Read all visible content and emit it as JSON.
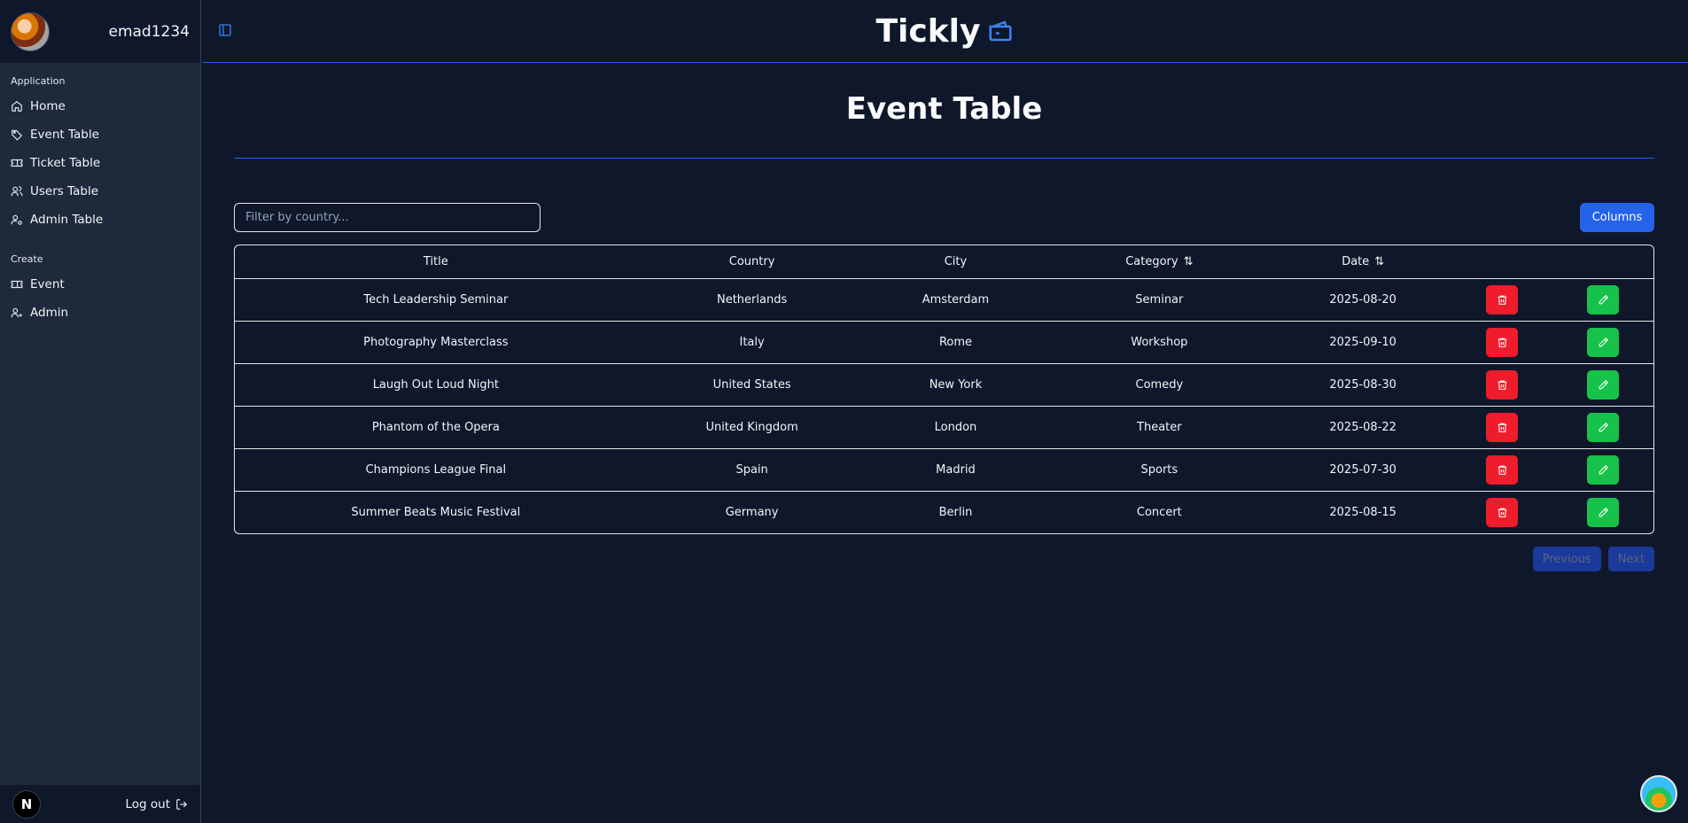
{
  "user": {
    "name": "emad1234"
  },
  "sidebar": {
    "application_label": "Application",
    "application_items": [
      {
        "label": "Home",
        "icon": "home-icon"
      },
      {
        "label": "Event Table",
        "icon": "tag-icon"
      },
      {
        "label": "Ticket Table",
        "icon": "ticket-icon"
      },
      {
        "label": "Users Table",
        "icon": "users-icon"
      },
      {
        "label": "Admin Table",
        "icon": "user-cog-icon"
      }
    ],
    "create_label": "Create",
    "create_items": [
      {
        "label": "Event",
        "icon": "ticket-icon"
      },
      {
        "label": "Admin",
        "icon": "user-plus-icon"
      }
    ],
    "footer_badge": "N",
    "logout_label": "Log out"
  },
  "header": {
    "brand": "Tickly",
    "brand_icon": "wallet-icon"
  },
  "page": {
    "title": "Event Table",
    "filter_placeholder": "Filter by country...",
    "columns_button": "Columns"
  },
  "table": {
    "headers": {
      "title": "Title",
      "country": "Country",
      "city": "City",
      "category": "Category",
      "date": "Date",
      "sort_glyph": "⇅"
    },
    "rows": [
      {
        "title": "Tech Leadership Seminar",
        "country": "Netherlands",
        "city": "Amsterdam",
        "category": "Seminar",
        "date": "2025-08-20"
      },
      {
        "title": "Photography Masterclass",
        "country": "Italy",
        "city": "Rome",
        "category": "Workshop",
        "date": "2025-09-10"
      },
      {
        "title": "Laugh Out Loud Night",
        "country": "United States",
        "city": "New York",
        "category": "Comedy",
        "date": "2025-08-30"
      },
      {
        "title": "Phantom of the Opera",
        "country": "United Kingdom",
        "city": "London",
        "category": "Theater",
        "date": "2025-08-22"
      },
      {
        "title": "Champions League Final",
        "country": "Spain",
        "city": "Madrid",
        "category": "Sports",
        "date": "2025-07-30"
      },
      {
        "title": "Summer Beats Music Festival",
        "country": "Germany",
        "city": "Berlin",
        "category": "Concert",
        "date": "2025-08-15"
      }
    ]
  },
  "pagination": {
    "previous": "Previous",
    "next": "Next"
  },
  "colors": {
    "accent": "#2563eb",
    "delete": "#ef1c2c",
    "edit": "#16c24a",
    "background": "#0f172a",
    "sidebar": "#1e293b"
  }
}
